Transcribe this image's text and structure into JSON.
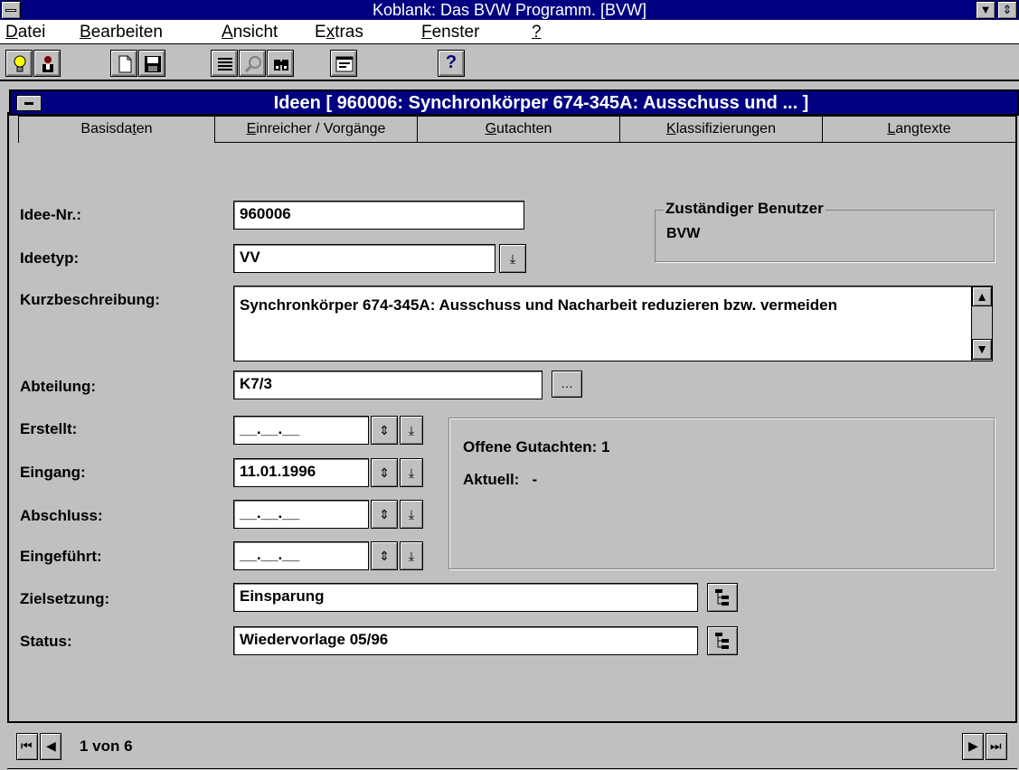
{
  "app": {
    "title": "Koblank: Das BVW Programm. [BVW]"
  },
  "menu": {
    "items": [
      {
        "first": "D",
        "rest": "atei"
      },
      {
        "first": "B",
        "rest": "earbeiten"
      },
      {
        "first": "A",
        "rest": "nsicht"
      },
      {
        "pre": "E",
        "first": "x",
        "rest": "tras"
      },
      {
        "first": "F",
        "rest": "enster"
      },
      {
        "first": "?",
        "rest": ""
      }
    ]
  },
  "toolbar": {
    "buttons": [
      "lightbulb-icon",
      "person-icon",
      "new-document-icon",
      "save-disk-icon",
      "list-icon",
      "magnifier-icon",
      "binoculars-icon",
      "form-icon",
      "help-icon"
    ],
    "help_label": "?"
  },
  "child": {
    "title": "Ideen  [ 960006: Synchronkörper 674-345A: Ausschuss und ... ]"
  },
  "tabs": [
    {
      "pre": "Basisda",
      "u": "t",
      "post": "en"
    },
    {
      "pre": "",
      "u": "E",
      "post": "inreicher / Vorgänge"
    },
    {
      "pre": "",
      "u": "G",
      "post": "utachten"
    },
    {
      "pre": "",
      "u": "K",
      "post": "lassifizierungen"
    },
    {
      "pre": "",
      "u": "L",
      "post": "angtexte"
    }
  ],
  "form": {
    "idee_nr": {
      "label": "Idee-Nr.:",
      "value": "960006"
    },
    "ideetyp": {
      "label": "Ideetyp:",
      "value": "VV"
    },
    "kurzbeschreibung": {
      "label": "Kurzbeschreibung:",
      "value": "Synchronkörper 674-345A: Ausschuss und Nacharbeit reduzieren bzw. vermeiden"
    },
    "abteilung": {
      "label": "Abteilung:",
      "value": "K7/3"
    },
    "erstellt": {
      "label": "Erstellt:",
      "value": "__.__.__"
    },
    "eingang": {
      "label": "Eingang:",
      "value": "11.01.1996"
    },
    "abschluss": {
      "label": "Abschluss:",
      "value": "__.__.__"
    },
    "eingefuehrt": {
      "label": "Eingeführt:",
      "value": "__.__.__"
    },
    "zielsetzung": {
      "label": "Zielsetzung:",
      "value": "Einsparung"
    },
    "status": {
      "label": "Status:",
      "value": "Wiedervorlage 05/96"
    }
  },
  "zustaendig": {
    "legend": "Zuständiger Benutzer",
    "value": "BVW"
  },
  "gutachten": {
    "offene_label": "Offene Gutachten:",
    "offene_value": "1",
    "aktuell_label": "Aktuell:",
    "aktuell_value": "-"
  },
  "nav": {
    "record": "1 von 6"
  }
}
